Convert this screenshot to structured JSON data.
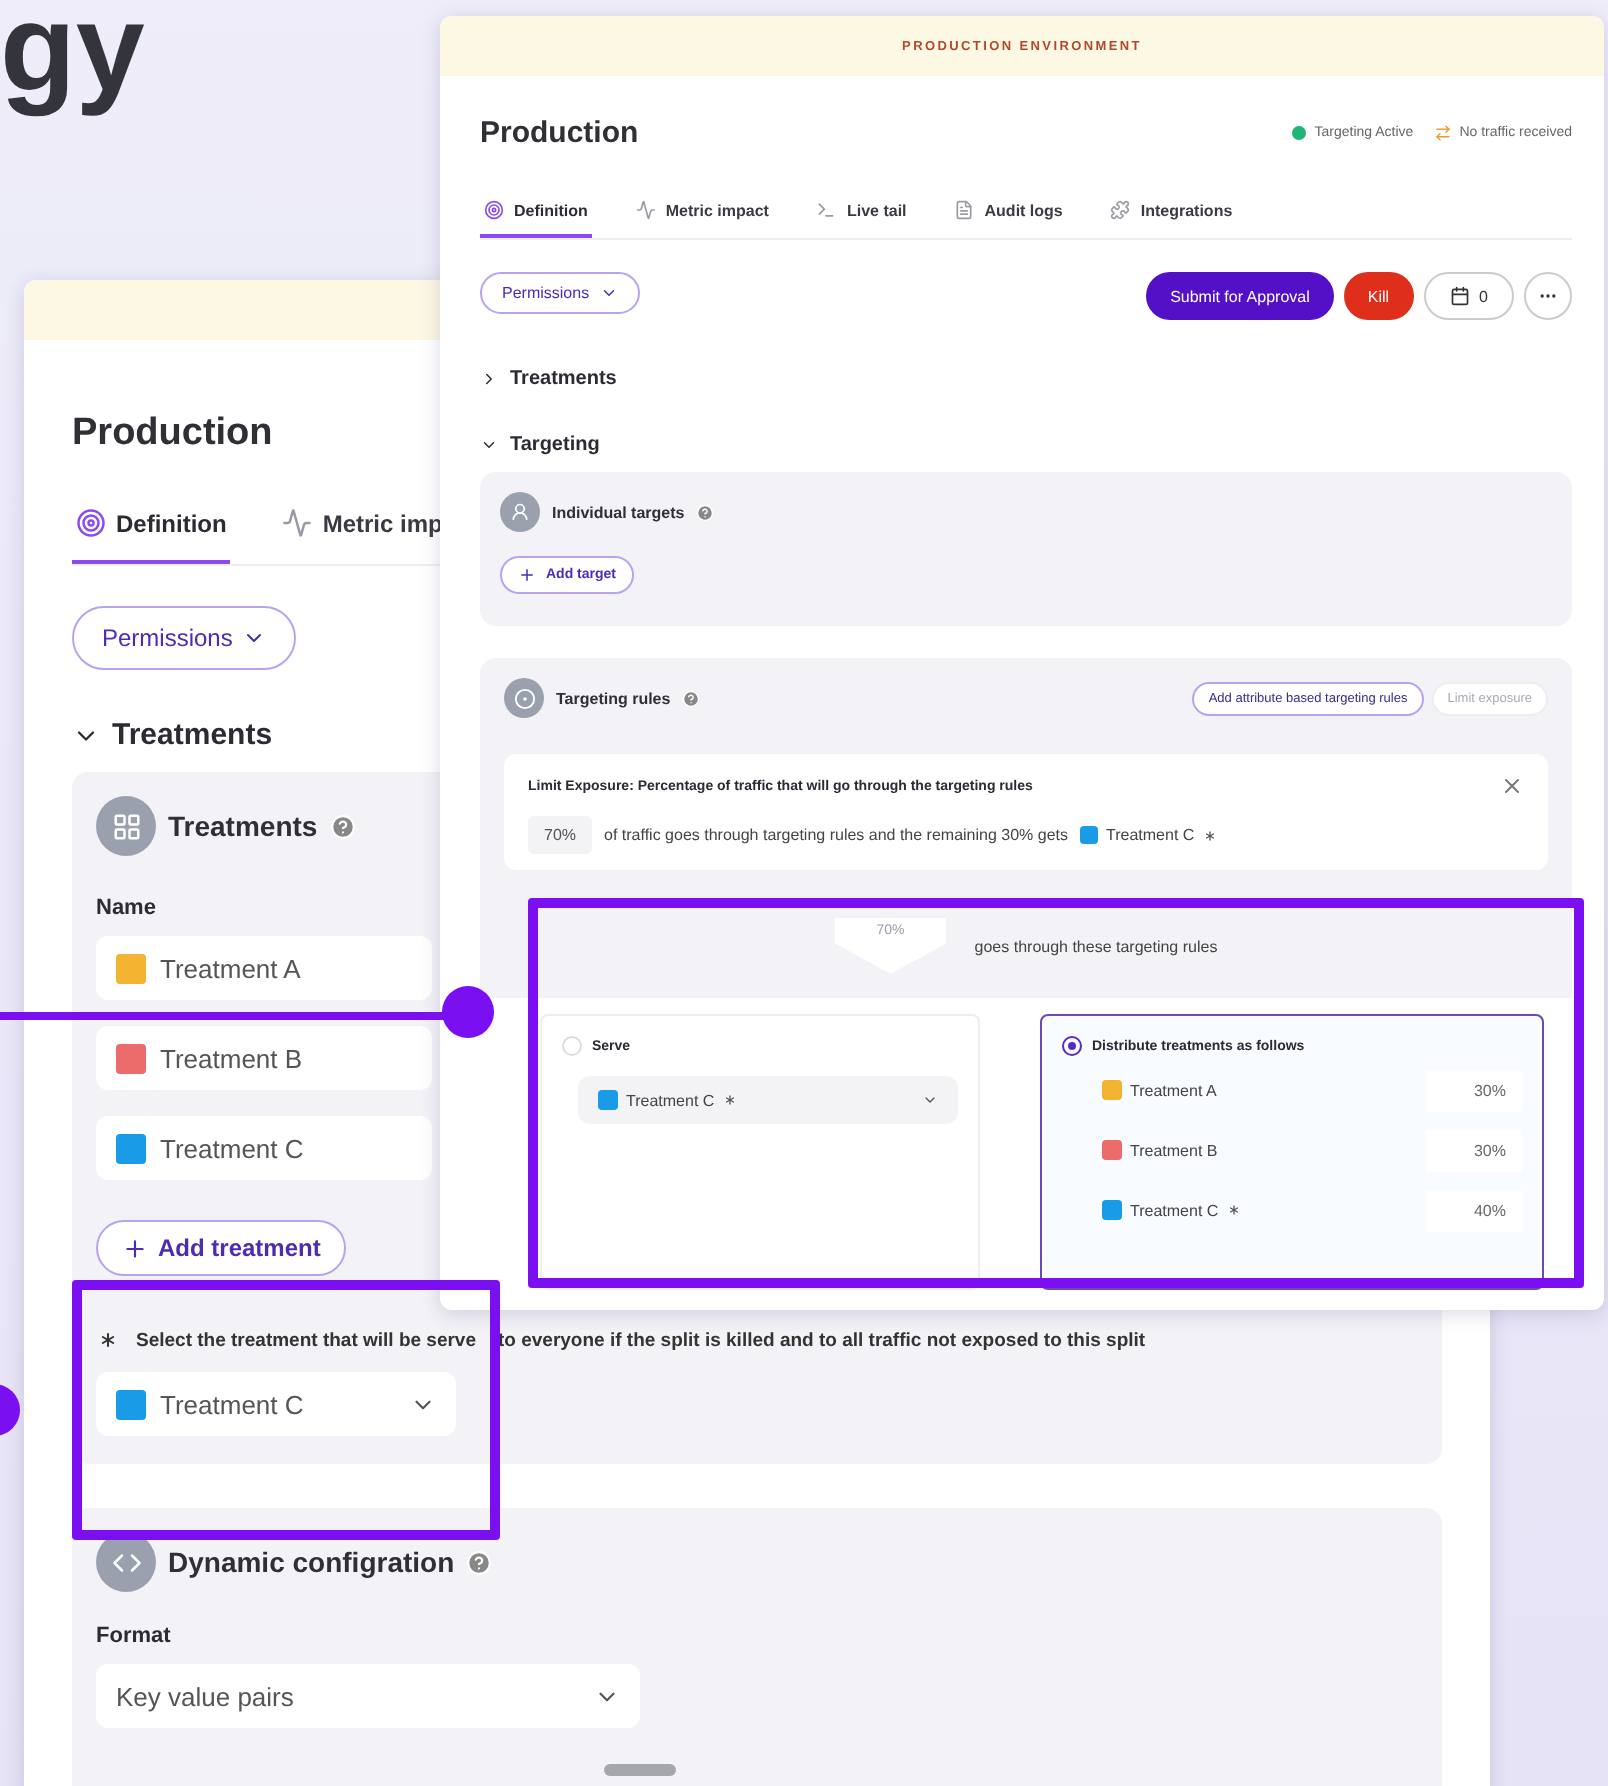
{
  "heading": "gy",
  "back_window": {
    "title": "Production",
    "tabs": [
      {
        "label": "Definition",
        "selected": true
      },
      {
        "label": "Metric imp",
        "selected": false
      }
    ],
    "permissions": "Permissions",
    "section": {
      "label": "Treatments",
      "expanded": true
    },
    "treatments_card": {
      "title": "Treatments",
      "name_label": "Name",
      "treatments": [
        {
          "name": "Treatment A",
          "color": "#f2b431"
        },
        {
          "name": "Treatment B",
          "color": "#ec6b6b"
        },
        {
          "name": "Treatment C",
          "color": "#1a9be8"
        }
      ],
      "add_button": "Add treatment",
      "default_note": [
        "Select the treatment that will be serve",
        "to everyone if the split is killed and to all traffic not exposed to this split"
      ],
      "default_select": {
        "name": "Treatment C",
        "color": "#1a9be8"
      }
    },
    "config_card": {
      "title": "Dynamic configration",
      "format_label": "Format",
      "format_select": "Key value pairs"
    }
  },
  "front_window": {
    "banner": "PRODUCTION ENVIRONMENT",
    "title": "Production",
    "statuses": [
      {
        "label": "Targeting Active",
        "kind": "dot"
      },
      {
        "label": "No traffic received",
        "kind": "arrows"
      }
    ],
    "tabs": [
      {
        "label": "Definition",
        "selected": true
      },
      {
        "label": "Metric impact",
        "selected": false
      },
      {
        "label": "Live tail",
        "selected": false
      },
      {
        "label": "Audit logs",
        "selected": false
      },
      {
        "label": "Integrations",
        "selected": false
      }
    ],
    "permissions": "Permissions",
    "actions": [
      {
        "label": "Submit for Approval",
        "kind": "primary"
      },
      {
        "label": "Kill",
        "kind": "danger"
      },
      {
        "label": "0",
        "kind": "calendar"
      },
      {
        "kind": "more"
      }
    ],
    "sections": [
      {
        "label": "Treatments",
        "expanded": false
      },
      {
        "label": "Targeting",
        "expanded": true
      }
    ],
    "individual_targets": {
      "title": "Individual targets",
      "add_button": "Add target"
    },
    "targeting_rules": {
      "title": "Targeting rules",
      "buttons": [
        {
          "label": "Add attribute based targeting rules",
          "disabled": false
        },
        {
          "label": "Limit exposure",
          "disabled": true
        }
      ],
      "limit_exposure": {
        "title": "Limit Exposure: Percentage of traffic that will go through the targeting rules",
        "percent": "70%",
        "sentence": "of traffic goes through targeting rules and the remaining 30% gets",
        "treatment": {
          "name": "Treatment C",
          "color": "#1a9be8",
          "default": true
        }
      },
      "flow": {
        "badge": "70%",
        "label": "goes through these targeting rules"
      },
      "options": [
        {
          "label": "Serve",
          "selected": false,
          "kind": "select",
          "value": {
            "name": "Treatment C",
            "color": "#1a9be8",
            "default": true
          }
        },
        {
          "label": "Distribute treatments as follows",
          "selected": true,
          "kind": "distribution",
          "rows": [
            {
              "name": "Treatment A",
              "color": "#f2b431",
              "default": false,
              "percent": "30%"
            },
            {
              "name": "Treatment B",
              "color": "#ec6b6b",
              "default": false,
              "percent": "30%"
            },
            {
              "name": "Treatment C",
              "color": "#1a9be8",
              "default": true,
              "percent": "40%"
            }
          ]
        }
      ]
    }
  }
}
